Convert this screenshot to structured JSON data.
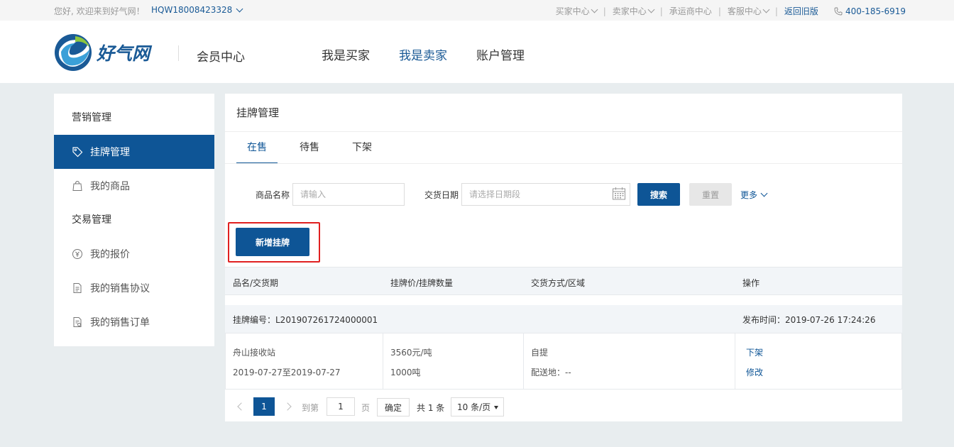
{
  "topbar": {
    "greeting": "您好, 欢迎来到好气网！",
    "user_id": "HQW18008423328",
    "nav": [
      {
        "label": "买家中心",
        "dropdown": true
      },
      {
        "label": "卖家中心",
        "dropdown": true
      },
      {
        "label": "承运商中心",
        "dropdown": false
      },
      {
        "label": "客服中心",
        "dropdown": true
      },
      {
        "label": "返回旧版",
        "dropdown": false
      }
    ],
    "phone": "400-185-6919"
  },
  "header": {
    "logo_text": "好气网",
    "member_center": "会员中心",
    "nav": [
      "我是买家",
      "我是卖家",
      "账户管理"
    ]
  },
  "sidebar": {
    "section1": "营销管理",
    "item_listing": "挂牌管理",
    "item_goods": "我的商品",
    "section2": "交易管理",
    "item_quote": "我的报价",
    "item_agreement": "我的销售协议",
    "item_order": "我的销售订单"
  },
  "content": {
    "title": "挂牌管理",
    "tabs": [
      "在售",
      "待售",
      "下架"
    ],
    "filter": {
      "name_label": "商品名称",
      "name_placeholder": "请输入",
      "date_label": "交货日期",
      "date_placeholder": "请选择日期段",
      "search": "搜索",
      "reset": "重置",
      "more": "更多"
    },
    "add_button": "新增挂牌",
    "table_headers": [
      "品名/交货期",
      "挂牌价/挂牌数量",
      "交货方式/区域",
      "操作"
    ],
    "order": {
      "listing_no": "挂牌编号：L201907261724000001",
      "publish_time": "发布时间：2019-07-26 17:24:26",
      "product": "舟山接收站",
      "period": "2019-07-27至2019-07-27",
      "price": "3560元/吨",
      "quantity": "1000吨",
      "delivery": "自提",
      "region": "配送地：--",
      "action_offshelf": "下架",
      "action_edit": "修改"
    },
    "pager": {
      "current": "1",
      "goto": "到第",
      "page_value": "1",
      "page_unit": "页",
      "confirm": "确定",
      "total": "共 1 条",
      "page_size": "10 条/页"
    }
  },
  "colors": {
    "primary": "#0e5596",
    "highlight": "#e02020",
    "bg": "#e8edef"
  }
}
